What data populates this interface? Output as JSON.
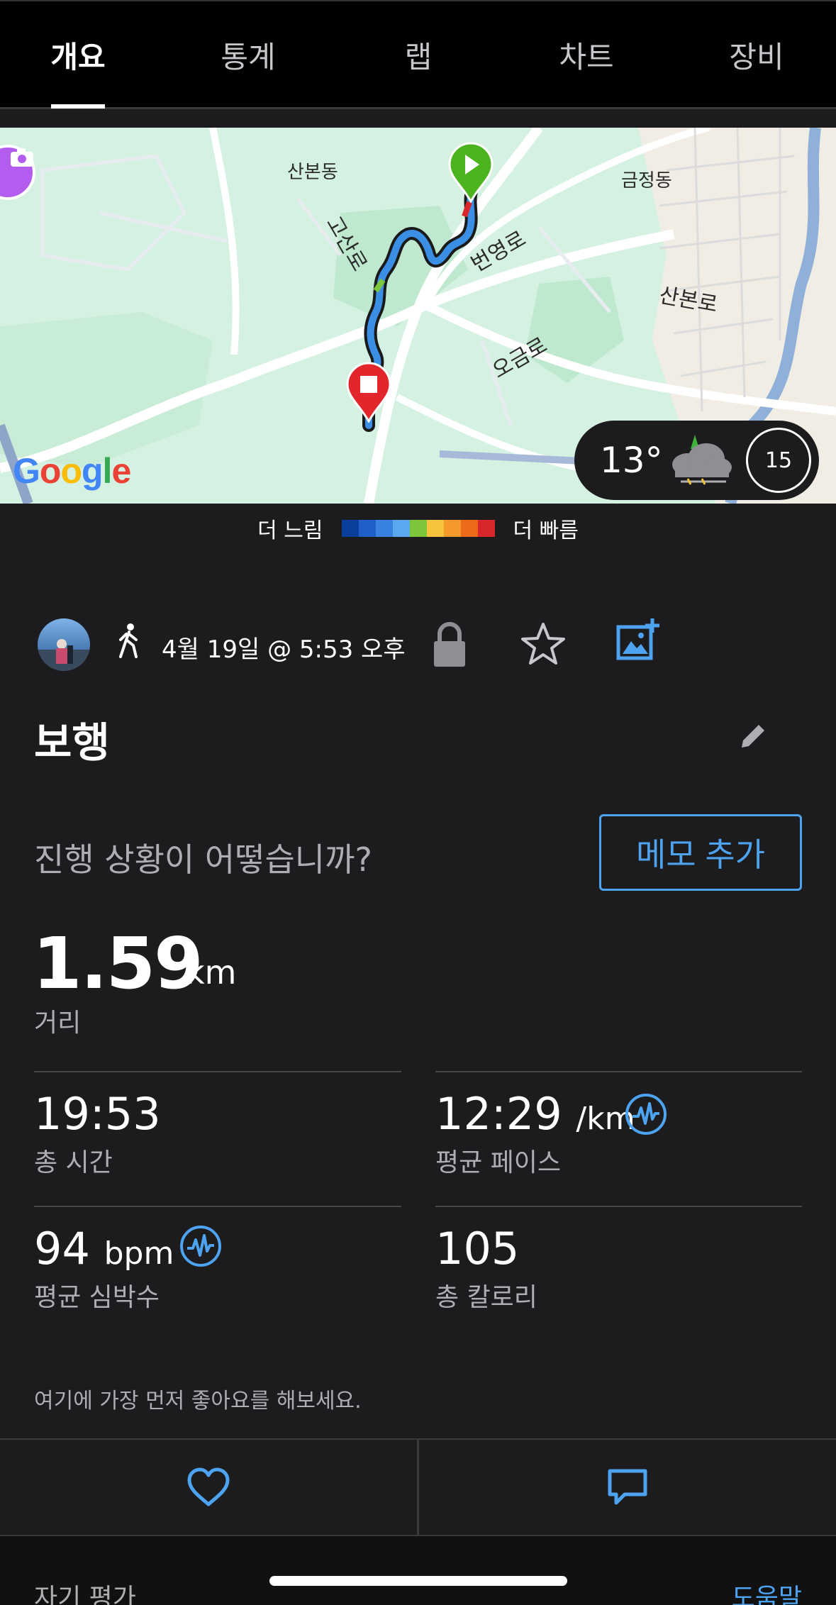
{
  "tabs": [
    {
      "label": "개요",
      "active": true
    },
    {
      "label": "통계",
      "active": false
    },
    {
      "label": "랩",
      "active": false
    },
    {
      "label": "차트",
      "active": false
    },
    {
      "label": "장비",
      "active": false
    }
  ],
  "map": {
    "labels": {
      "sanbon_dong": "산본동",
      "geumjeong_dong": "금정동",
      "gosan_ro": "고산로",
      "beonyeong_ro": "번영로",
      "sanbon_ro": "산본로",
      "ogeum_ro": "오금로"
    },
    "attribution": [
      "G",
      "o",
      "o",
      "g",
      "l",
      "e"
    ],
    "weather": {
      "temperature": "13°",
      "wind": "15"
    }
  },
  "legend": {
    "slow_label": "더 느림",
    "fast_label": "더 빠름",
    "colors": [
      "#0a3f9c",
      "#1f5fc9",
      "#3a82e0",
      "#5aa8ef",
      "#7dc63b",
      "#f7c33c",
      "#f59a2a",
      "#ec6a1a",
      "#d8272b"
    ]
  },
  "activity": {
    "date": "4월 19일 @ 5:53 오후",
    "title": "보행",
    "question": "진행 상황이 어떻습니까?",
    "memo_button": "메모 추가",
    "distance": {
      "value": "1.59",
      "unit": "km",
      "label": "거리"
    },
    "total_time": {
      "value": "19:53",
      "label": "총 시간"
    },
    "avg_pace": {
      "value": "12:29",
      "unit": "/km",
      "label": "평균 페이스"
    },
    "avg_hr": {
      "value": "94",
      "unit": "bpm",
      "label": "평균 심박수"
    },
    "calories": {
      "value": "105",
      "label": "총 칼로리"
    },
    "like_note": "여기에 가장 먼저 좋아요를 해보세요."
  },
  "bottom": {
    "self_eval": "자기 평가",
    "help": "도움말"
  },
  "colors": {
    "accent": "#4da3f0",
    "background": "#1c1c1e",
    "tab_bg": "#000000"
  }
}
